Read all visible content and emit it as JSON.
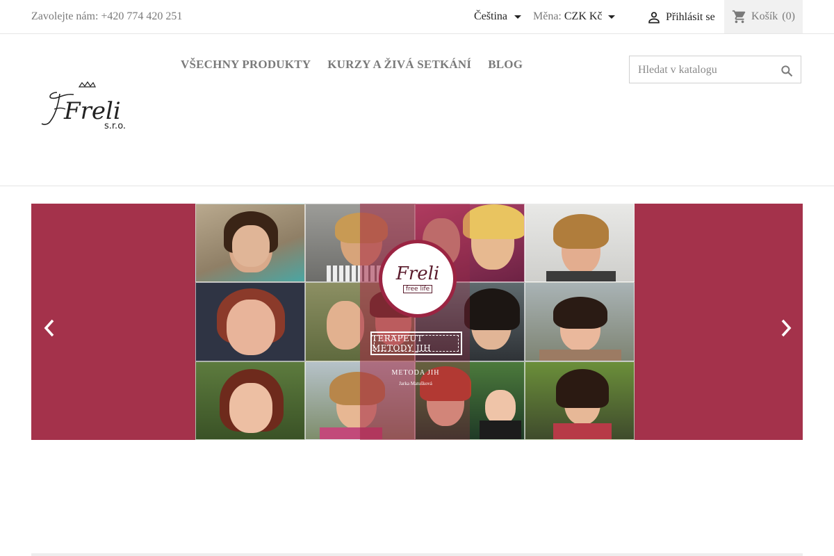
{
  "topbar": {
    "contact_text": "Zavolejte nám: +420 774 420 251",
    "language": "Čeština",
    "currency_label": "Měna:",
    "currency_value": "CZK Kč",
    "signin_label": "Přihlásit se",
    "cart_label": "Košík",
    "cart_count": "(0)"
  },
  "header": {
    "logo_text": "Freli",
    "logo_suffix": "s.r.o.",
    "menu": [
      {
        "label": "VŠECHNY PRODUKTY"
      },
      {
        "label": "KURZY A ŽIVÁ SETKÁNÍ"
      },
      {
        "label": "BLOG"
      }
    ],
    "search_placeholder": "Hledat v katalogu"
  },
  "slider": {
    "badge_title": "Freli",
    "badge_subtitle": "free life",
    "tag_text": "TERAPEUT METODY JIH",
    "method_text": "METODA JIH",
    "author_text": "Jarka Matušková",
    "background_color": "#a4324b"
  },
  "icons": {
    "user": "user-icon",
    "cart": "cart-icon",
    "search": "search-icon",
    "prev": "chevron-left-icon",
    "next": "chevron-right-icon"
  }
}
